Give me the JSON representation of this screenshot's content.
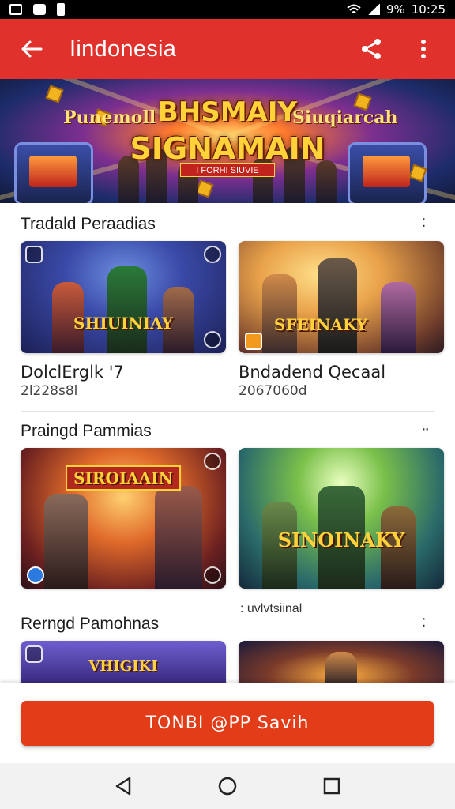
{
  "status_bar": {
    "battery": "9%",
    "time": "10:25"
  },
  "app_bar": {
    "title": "Iindonesia"
  },
  "hero": {
    "side_left": "Punemoll",
    "line1": "BHSMAIY",
    "side_right": "Siuqiarcah",
    "line2": "SIGNAMAIN",
    "ribbon": "I FORHI SIUVIE"
  },
  "sections": [
    {
      "title": "Tradald Peraadias",
      "items": [
        {
          "logo": "SHIUINIAY",
          "title": "DolclErglk '7",
          "subtitle": "2l228s8l"
        },
        {
          "logo": "SFEINAKY",
          "title": "Bndadend Qecaal",
          "subtitle": "2067060d"
        }
      ]
    },
    {
      "title": "Praingd Pammias",
      "items": [
        {
          "logo": "SIROIAAIN",
          "title": "",
          "subtitle": ""
        },
        {
          "logo": "SINOINAKY",
          "title": "",
          "subtitle": ""
        }
      ],
      "extra_label": ": uvlvtsiinal"
    },
    {
      "title": "Rerngd Pamohnas",
      "items": [
        {
          "logo": "VHIGIKI",
          "title": "",
          "subtitle": ""
        },
        {
          "logo": "",
          "title": "",
          "subtitle": ""
        }
      ]
    }
  ],
  "cta": {
    "label": "TONBI @PP  Savih"
  },
  "colors": {
    "app_bar": "#e0312c",
    "cta": "#e23d18",
    "nav_bar": "#f2f2f2"
  },
  "icons": [
    "image-icon",
    "app-icon",
    "sim-icon",
    "wifi-icon",
    "signal-icon",
    "back-arrow-icon",
    "share-icon",
    "overflow-menu-icon",
    "more-dots-icon",
    "nav-back-icon",
    "nav-home-icon",
    "nav-recents-icon"
  ]
}
